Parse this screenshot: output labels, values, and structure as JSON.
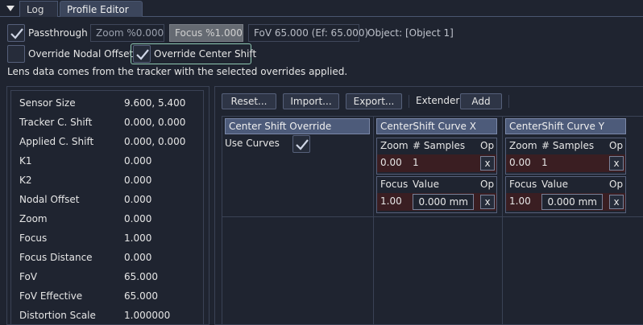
{
  "tabs": {
    "menu_icon": "triangle-down-icon",
    "log": "Log",
    "profile_editor": "Profile Editor"
  },
  "top": {
    "passthrough_label": "Passthrough",
    "passthrough_checked": true,
    "zoom": "Zoom %0.000",
    "focus": "Focus %1.000",
    "fov": "FoV 65.000 (Ef: 65.000)",
    "object": "Object: [Object 1]",
    "override_nodal_label": "Override Nodal Offset",
    "override_nodal_checked": false,
    "override_center_label": "Override Center Shift",
    "override_center_checked": true,
    "description": "Lens data comes from the tracker with the selected overrides applied."
  },
  "info": [
    {
      "k": "Sensor Size",
      "v": "9.600, 5.400"
    },
    {
      "k": "Tracker C. Shift",
      "v": "0.000, 0.000"
    },
    {
      "k": "Applied C. Shift",
      "v": "0.000, 0.000"
    },
    {
      "k": "K1",
      "v": "0.000"
    },
    {
      "k": "K2",
      "v": "0.000"
    },
    {
      "k": "Nodal Offset",
      "v": "0.000"
    },
    {
      "k": "Zoom",
      "v": "0.000"
    },
    {
      "k": "Focus",
      "v": "1.000"
    },
    {
      "k": "Focus Distance",
      "v": "0.000"
    },
    {
      "k": "FoV",
      "v": "65.000"
    },
    {
      "k": "FoV Effective",
      "v": "65.000"
    },
    {
      "k": "Distortion Scale",
      "v": "1.000000"
    }
  ],
  "toolbar": {
    "reset": "Reset...",
    "import": "Import...",
    "export": "Export...",
    "extender": "Extender",
    "add": "Add"
  },
  "center_shift": {
    "header": "Center Shift Override",
    "use_curves": "Use Curves",
    "use_curves_checked": true
  },
  "curve_x": {
    "header": "CenterShift Curve X",
    "zoom_cols": [
      "Zoom",
      "# Samples",
      "Op"
    ],
    "zoom_row": [
      "0.00",
      "1",
      "x"
    ],
    "focus_cols": [
      "Focus",
      "Value",
      "Op"
    ],
    "focus_row": [
      "1.00",
      "0.000 mm",
      "x"
    ]
  },
  "curve_y": {
    "header": "CenterShift Curve Y",
    "zoom_cols": [
      "Zoom",
      "# Samples",
      "Op"
    ],
    "zoom_row": [
      "0.00",
      "1",
      "x"
    ],
    "focus_cols": [
      "Focus",
      "Value",
      "Op"
    ],
    "focus_row": [
      "1.00",
      "0.000 mm",
      "x"
    ]
  }
}
